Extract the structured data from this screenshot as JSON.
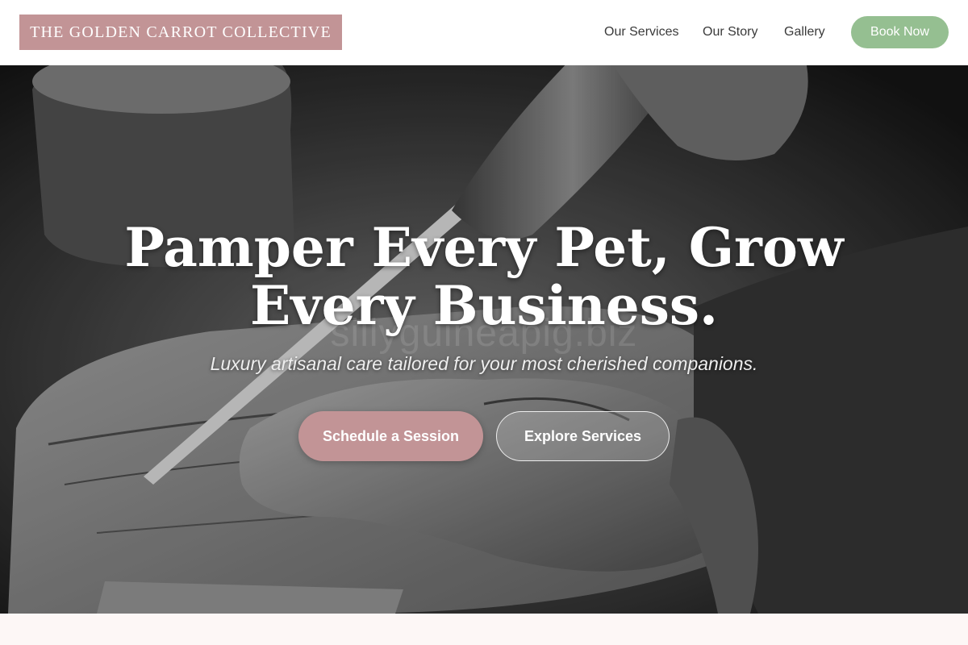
{
  "header": {
    "logo": "THE GOLDEN CARROT COLLECTIVE",
    "nav": [
      "Our Services",
      "Our Story",
      "Gallery"
    ],
    "cta": "Book Now"
  },
  "hero": {
    "title_line1": "Pamper Every Pet, Grow",
    "title_line2": "Every Business.",
    "subtitle": "Luxury artisanal care tailored for your most cherished companions.",
    "watermark": "sillyguineapig.biz",
    "primary_button": "Schedule a Session",
    "secondary_button": "Explore Services",
    "image": "woodcarving-chisel-hands-photo"
  },
  "colors": {
    "brand_rose": "#c29496",
    "accent_green": "#95bf91",
    "section_bg": "#fdf7f6"
  }
}
